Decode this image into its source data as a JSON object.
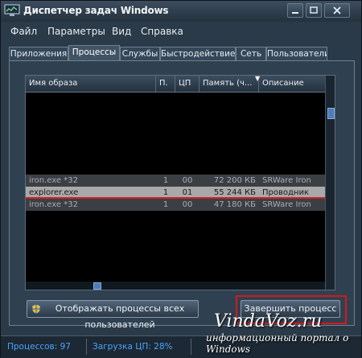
{
  "window": {
    "title": "Диспетчер задач Windows"
  },
  "menu": [
    "Файл",
    "Параметры",
    "Вид",
    "Справка"
  ],
  "tabs": [
    "Приложения",
    "Процессы",
    "Службы",
    "Быстродействие",
    "Сеть",
    "Пользователи"
  ],
  "active_tab": "Процессы",
  "table": {
    "columns": [
      "Имя образа",
      "П.",
      "ЦП",
      "Память (ч...",
      "Описание"
    ],
    "sorted_column": "Память (ч...",
    "rows": [
      {
        "name": "iron.exe *32",
        "user": "1",
        "cpu": "00",
        "memory": "72 200 КБ",
        "description": "SRWare Iron",
        "state": "normal"
      },
      {
        "name": "explorer.exe",
        "user": "1",
        "cpu": "01",
        "memory": "55 244 КБ",
        "description": "Проводник",
        "state": "selected"
      },
      {
        "name": "iron.exe *32",
        "user": "1",
        "cpu": "00",
        "memory": "47 180 КБ",
        "description": "SRWare Iron",
        "state": "normal"
      }
    ]
  },
  "show_all_button": "Отображать процессы всех пользователей",
  "end_process_button": "Завершить процесс",
  "status": {
    "processes": "Процессов: 97",
    "cpu_load": "Загрузка ЦП: 28%"
  },
  "watermark": {
    "site": "VindaVoz.ru",
    "tagline": "информационный портал о Windows"
  },
  "colors": {
    "highlight": "#d21a1a",
    "status_text": "#4aa3ff",
    "selection": "#a9a9a9"
  }
}
